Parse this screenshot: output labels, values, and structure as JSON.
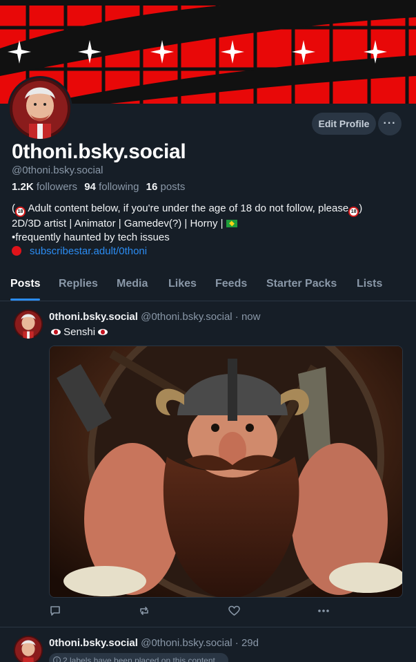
{
  "profile": {
    "display_name": "0thoni.bsky.social",
    "handle": "@0thoni.bsky.social",
    "edit_label": "Edit Profile",
    "more_label": "···",
    "followers_count": "1.2K",
    "followers_label": "followers",
    "following_count": "94",
    "following_label": "following",
    "posts_count": "16",
    "posts_label": "posts",
    "bio": {
      "line1_a": "(",
      "line1_b": "Adult content below, if you're under the age of 18 do not follow, please",
      "line1_c": ")",
      "line2": "2D/3D artist | Animator | Gamedev(?) | Horny |",
      "line3": "•frequently haunted by tech issues",
      "link": "subscribestar.adult/0thoni"
    },
    "badge_text": "18",
    "accent_color": "#2b8cf2"
  },
  "tabs": [
    {
      "label": "Posts"
    },
    {
      "label": "Replies"
    },
    {
      "label": "Media"
    },
    {
      "label": "Likes"
    },
    {
      "label": "Feeds"
    },
    {
      "label": "Starter Packs"
    },
    {
      "label": "Lists"
    }
  ],
  "posts": [
    {
      "author": "0thoni.bsky.social",
      "handle": "@0thoni.bsky.social",
      "time": "· now",
      "text": "Senshi",
      "icons": [
        "reply-icon",
        "repost-icon",
        "like-icon",
        "more-icon"
      ]
    },
    {
      "author": "0thoni.bsky.social",
      "handle": "@0thoni.bsky.social",
      "time": "· 29d",
      "label_note": "2 labels have been placed on this content"
    }
  ]
}
